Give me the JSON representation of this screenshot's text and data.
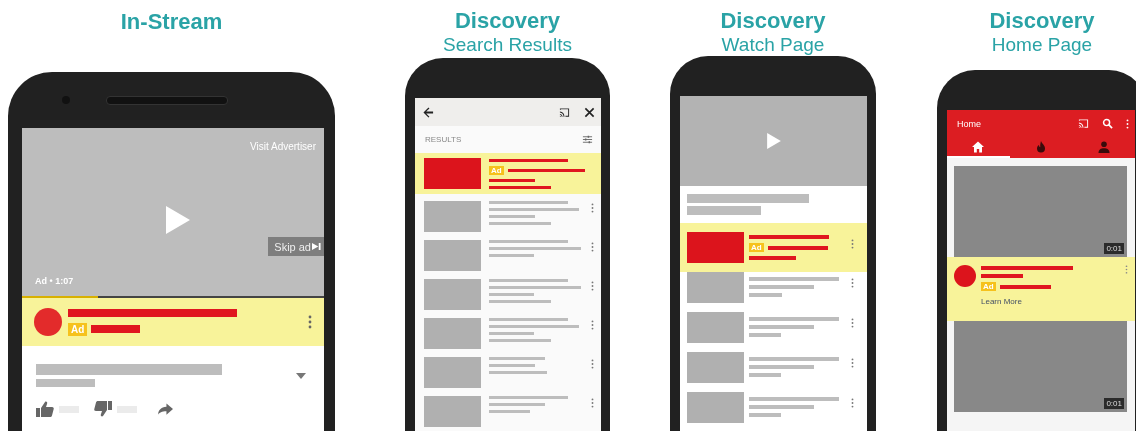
{
  "panels": [
    {
      "kind": "in_stream",
      "title": "In-Stream",
      "player": {
        "link": "Visit Advertiser",
        "skip": "Skip ad",
        "time": "Ad • 1:07",
        "level": 0.25
      },
      "badge": "Ad"
    },
    {
      "kind": "search",
      "title": "Discovery",
      "subtitle": "Search Results",
      "section": "RESULTS",
      "badge": "Ad"
    },
    {
      "kind": "watch",
      "title": "Discovery",
      "subtitle": "Watch Page",
      "badge": "Ad"
    },
    {
      "kind": "home",
      "title": "Discovery",
      "subtitle": "Home Page",
      "header": "Home",
      "tabs": [
        {
          "kind": "home",
          "selected": true
        },
        {
          "kind": "trending",
          "selected": false
        },
        {
          "kind": "account",
          "selected": false
        }
      ],
      "durations": [
        "0:01",
        "0:01"
      ],
      "badge": "Ad",
      "cta": "Learn More"
    }
  ]
}
